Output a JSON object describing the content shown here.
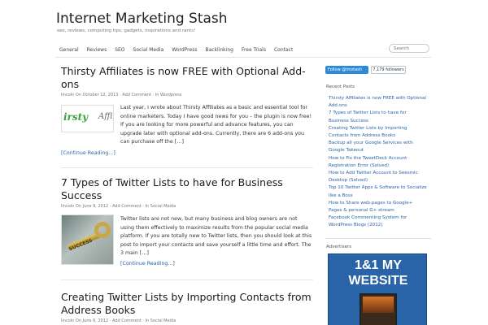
{
  "site": {
    "title": "Internet Marketing Stash",
    "tagline": "seo, reviews, computing tips, gadgets, inspirations and rants!"
  },
  "nav": {
    "items": [
      "General",
      "Reviews",
      "SEO",
      "Social Media",
      "WordPress",
      "Backlinking",
      "Free Trials",
      "Contact"
    ],
    "search_placeholder": "Search"
  },
  "posts": [
    {
      "title": "Thirsty Affiliates is now FREE with Optional Add-ons",
      "meta": {
        "author": "lincoln",
        "date": "On October 12, 2013",
        "comment": "Add Comment",
        "category": "In Wordpress"
      },
      "thumbnail": {
        "alt_text_1": "irsty",
        "alt_text_2": "Affili"
      },
      "excerpt": "Last year, I wrote about Thirsty Affiliates as a basic and essential tool for online marketers. Today I have good news for you – the plugin is now free! If you are looking for more powerful and advance features, you can upgrade later with optional add-ons. Currently, there are 6 add-ons you can purchase off the […]",
      "read_more": "[Continue Reading...]"
    },
    {
      "title": "7 Types of Twitter Lists to have for Business Success",
      "meta": {
        "author": "lincoln",
        "date": "On June 9, 2012",
        "comment": "Add Comment",
        "category": "In Social Media"
      },
      "thumbnail": {
        "word": "SUCCESS"
      },
      "excerpt": "Twitter lists are not new, but many business and blog owners are not using them effectively to maximize results from the popular social media platform. If you are totally new to Twitter lists, then you should look at this post to import your contacts and save yourself a little time and effort. The 3 main […]",
      "read_more": "[Continue Reading...]"
    },
    {
      "title": "Creating Twitter Lists by Importing Contacts from Address Books",
      "meta": {
        "author": "lincoln",
        "date": "On June 6, 2012",
        "comment": "Add Comment",
        "category": "In Social Media"
      }
    }
  ],
  "sidebar": {
    "twitter_follow": "Follow @imstash",
    "twitter_followers": "7,179 followers",
    "recent_heading": "Recent Posts",
    "recent_posts": [
      "Thirsty Affiliates is now FREE with Optional",
      "Add-ons",
      "7 Types of Twitter Lists to have for",
      "Business Success",
      "Creating Twitter Lists by Importing",
      "Contacts from Address Books",
      "Backup all your Google Services with",
      "Google Takeout",
      "How to Fix the TweetDeck Account",
      "Registration Error (Solved)",
      "How to Add Twitter Account to Seesmic",
      "Desktop (Solved)",
      "Top 10 Twitter Apps & Software to Socialize",
      "like a Boss",
      "How to Share web-pages to Google+",
      "Pages & personal G+ stream",
      "Facebook Commenting System for",
      "WordPress Blogs (2012)"
    ],
    "advertisers_heading": "Advertisers",
    "ad": {
      "line1": "1&1 MY",
      "line2": "WEBSITE"
    }
  },
  "colors": {
    "link": "#2a64a8",
    "twitter": "#2d8ad9",
    "ad_bg": "#2a64a8"
  }
}
